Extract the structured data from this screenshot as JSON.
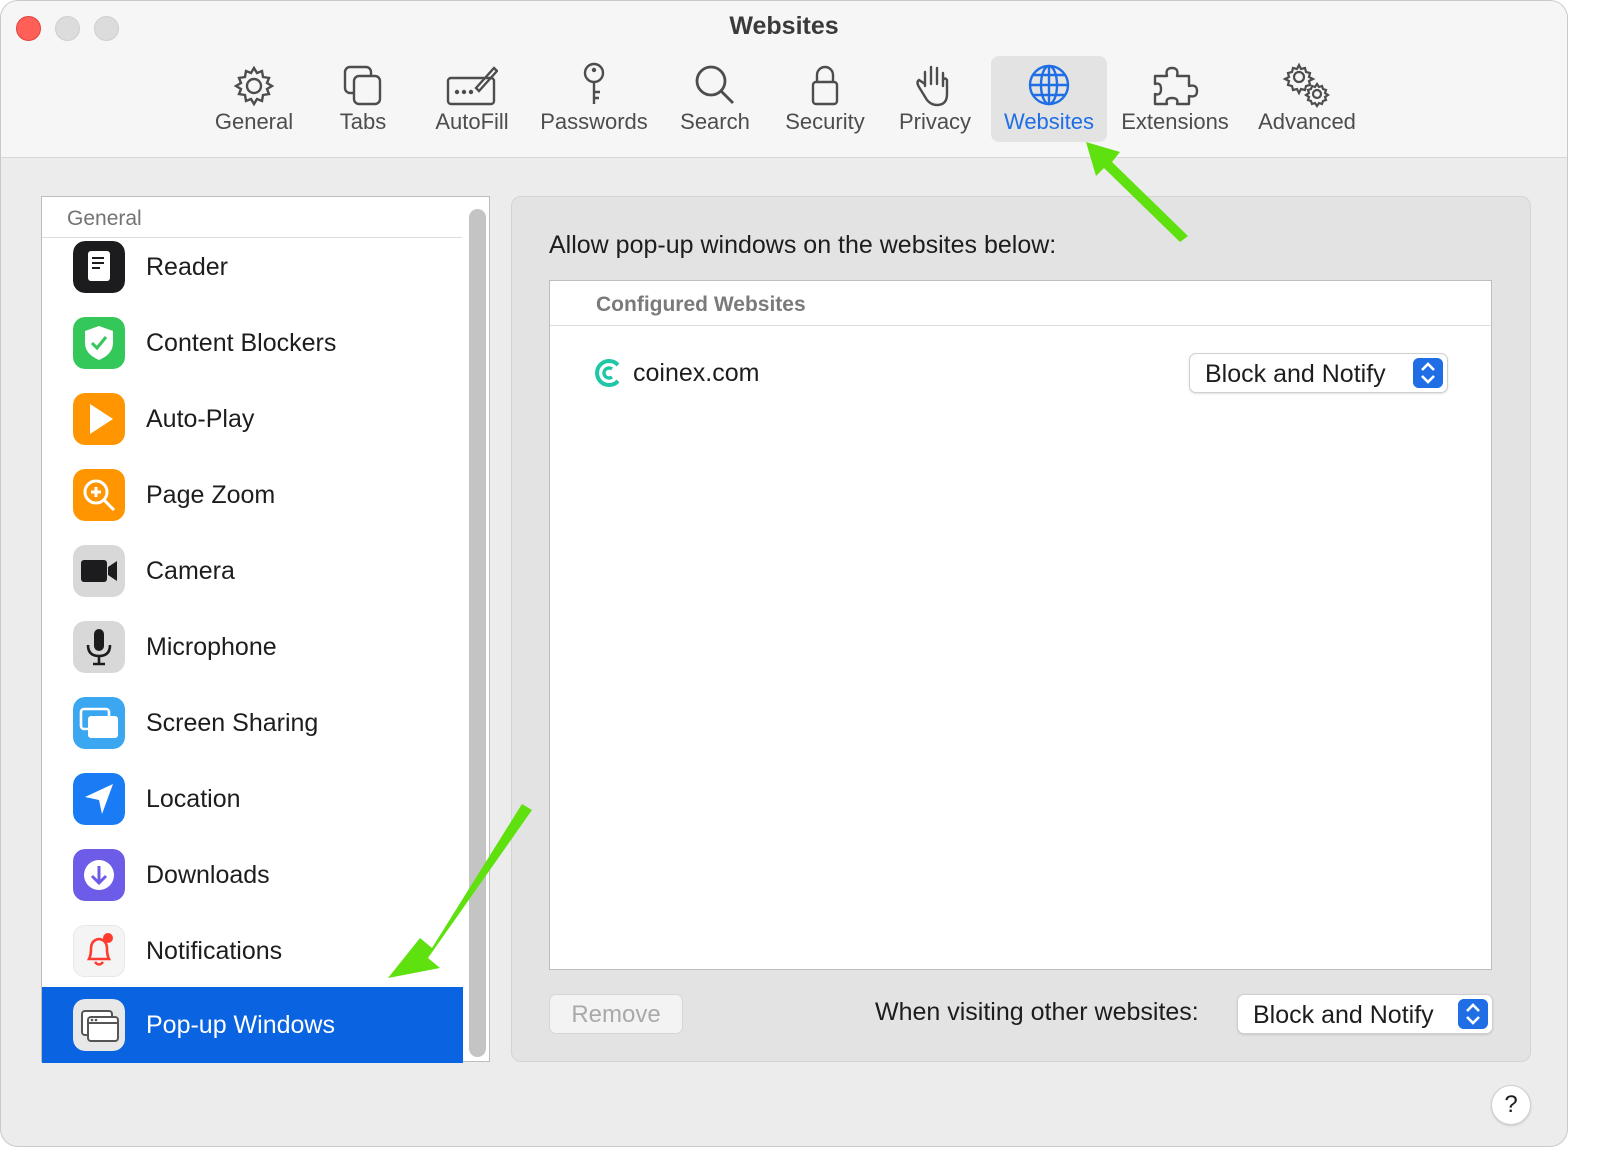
{
  "window": {
    "title": "Websites"
  },
  "toolbar": {
    "items": [
      {
        "label": "General",
        "icon": "gear-icon"
      },
      {
        "label": "Tabs",
        "icon": "tabs-icon"
      },
      {
        "label": "AutoFill",
        "icon": "autofill-icon"
      },
      {
        "label": "Passwords",
        "icon": "key-icon"
      },
      {
        "label": "Search",
        "icon": "search-icon"
      },
      {
        "label": "Security",
        "icon": "lock-icon"
      },
      {
        "label": "Privacy",
        "icon": "hand-icon"
      },
      {
        "label": "Websites",
        "icon": "globe-icon",
        "active": true
      },
      {
        "label": "Extensions",
        "icon": "puzzle-icon"
      },
      {
        "label": "Advanced",
        "icon": "gears-icon"
      }
    ]
  },
  "sidebar": {
    "header": "General",
    "items": [
      {
        "label": "Reader",
        "icon": "reader-icon"
      },
      {
        "label": "Content Blockers",
        "icon": "shield-check-icon"
      },
      {
        "label": "Auto-Play",
        "icon": "play-icon"
      },
      {
        "label": "Page Zoom",
        "icon": "zoom-icon"
      },
      {
        "label": "Camera",
        "icon": "camera-icon"
      },
      {
        "label": "Microphone",
        "icon": "microphone-icon"
      },
      {
        "label": "Screen Sharing",
        "icon": "screen-sharing-icon"
      },
      {
        "label": "Location",
        "icon": "location-icon"
      },
      {
        "label": "Downloads",
        "icon": "download-icon"
      },
      {
        "label": "Notifications",
        "icon": "bell-icon"
      },
      {
        "label": "Pop-up Windows",
        "icon": "popup-windows-icon",
        "selected": true
      }
    ]
  },
  "main": {
    "heading": "Allow pop-up windows on the websites below:",
    "table_header": "Configured Websites",
    "sites": [
      {
        "name": "coinex.com",
        "setting": "Block and Notify"
      }
    ],
    "remove_label": "Remove",
    "other_label": "When visiting other websites:",
    "other_setting": "Block and Notify",
    "help_label": "?"
  },
  "colors": {
    "accent": "#1f6ee6",
    "selection": "#0a63e0",
    "annotation_arrow": "#5fe00f"
  }
}
